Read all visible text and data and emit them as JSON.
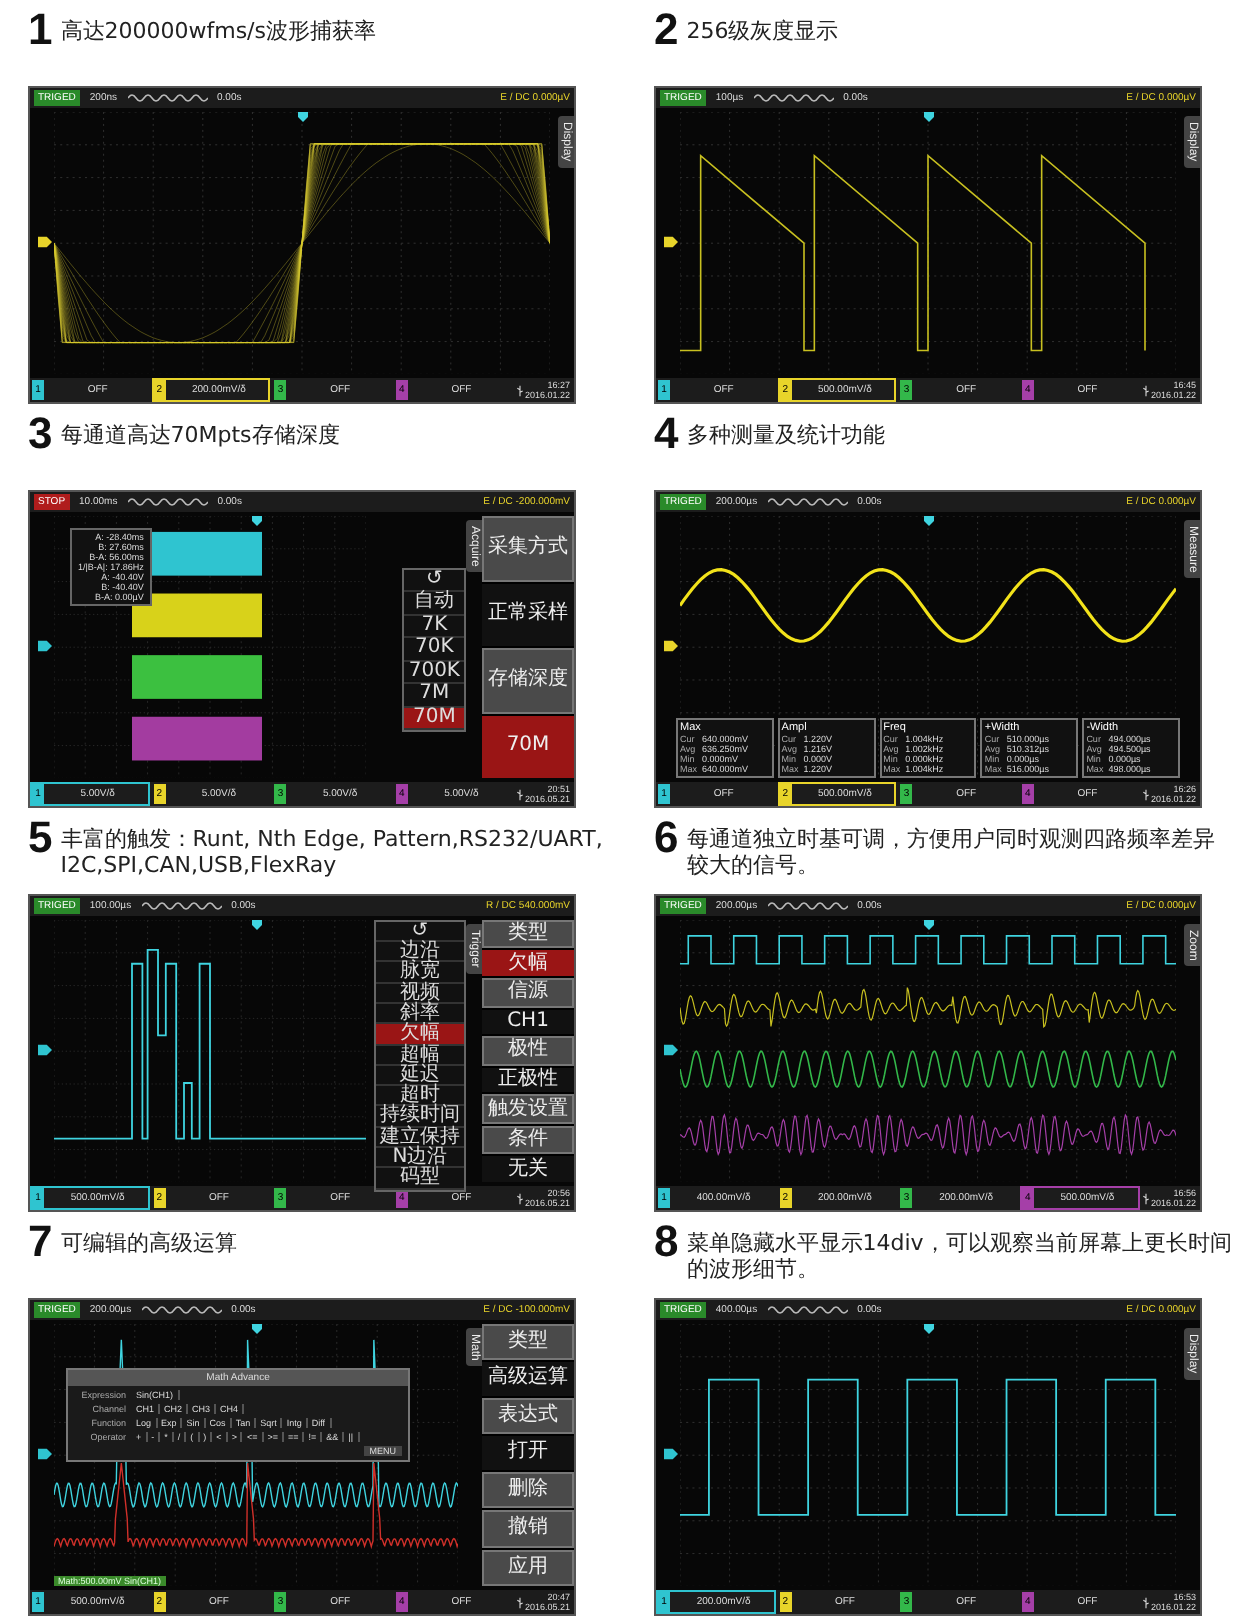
{
  "panels": [
    {
      "number": "1",
      "caption": "高达200000wfms/s波形捕获率",
      "screen": {
        "status": "TRIGED",
        "stopped": false,
        "timebase": "200ns",
        "delay": "0.00s",
        "trigger": "E / DC 0.000µV",
        "side_tab": "Display",
        "channels": [
          {
            "label": "1",
            "value": "OFF",
            "selected": false,
            "color": "#2fc4d0"
          },
          {
            "label": "2",
            "value": "200.00mV/δ",
            "selected": true,
            "color": "#e8d42a"
          },
          {
            "label": "3",
            "value": "OFF",
            "selected": false,
            "color": "#33b84a"
          },
          {
            "label": "4",
            "value": "OFF",
            "selected": false,
            "color": "#a53fa8"
          }
        ],
        "time": "16:27",
        "date": "2016.01.22"
      }
    },
    {
      "number": "2",
      "caption": "256级灰度显示",
      "screen": {
        "status": "TRIGED",
        "stopped": false,
        "timebase": "100µs",
        "delay": "0.00s",
        "trigger": "E / DC 0.000µV",
        "side_tab": "Display",
        "channels": [
          {
            "label": "1",
            "value": "OFF",
            "selected": false,
            "color": "#2fc4d0"
          },
          {
            "label": "2",
            "value": "500.00mV/δ",
            "selected": true,
            "color": "#e8d42a"
          },
          {
            "label": "3",
            "value": "OFF",
            "selected": false,
            "color": "#33b84a"
          },
          {
            "label": "4",
            "value": "OFF",
            "selected": false,
            "color": "#a53fa8"
          }
        ],
        "time": "16:45",
        "date": "2016.01.22"
      }
    },
    {
      "number": "3",
      "caption": "每通道高达70Mpts存储深度",
      "screen": {
        "status": "STOP",
        "stopped": true,
        "timebase": "10.00ms",
        "delay": "0.00s",
        "trigger": "E / DC -200.000mV",
        "side_tab": "Acquire",
        "cursor_readout": [
          "A: -28.40ms",
          "B: 27.60ms",
          "B-A: 56.00ms",
          "1/|B-A|: 17.86Hz",
          "A: -40.40V",
          "B: -40.40V",
          "B-A: 0.00µV"
        ],
        "popup_list": [
          {
            "label": "↺",
            "selected": false
          },
          {
            "label": "自动",
            "selected": false
          },
          {
            "label": "7K",
            "selected": false
          },
          {
            "label": "70K",
            "selected": false
          },
          {
            "label": "700K",
            "selected": false
          },
          {
            "label": "7M",
            "selected": false
          },
          {
            "label": "70M",
            "selected": true
          }
        ],
        "menu": [
          {
            "kind": "header",
            "label": "采集方式",
            "selected": false
          },
          {
            "kind": "value",
            "label": "正常采样",
            "selected": false
          },
          {
            "kind": "header",
            "label": "存储深度",
            "selected": false
          },
          {
            "kind": "value",
            "label": "70M",
            "selected": true
          }
        ],
        "channels": [
          {
            "label": "1",
            "value": "5.00V/δ",
            "selected": true,
            "color": "#2fc4d0"
          },
          {
            "label": "2",
            "value": "5.00V/δ",
            "selected": false,
            "color": "#e8d42a"
          },
          {
            "label": "3",
            "value": "5.00V/δ",
            "selected": false,
            "color": "#33b84a"
          },
          {
            "label": "4",
            "value": "5.00V/δ",
            "selected": false,
            "color": "#a53fa8"
          }
        ],
        "time": "20:51",
        "date": "2016.05.21"
      }
    },
    {
      "number": "4",
      "caption": "多种测量及统计功能",
      "screen": {
        "status": "TRIGED",
        "stopped": false,
        "timebase": "200.00µs",
        "delay": "0.00s",
        "trigger": "E / DC 0.000µV",
        "side_tab": "Measure",
        "measurements": [
          {
            "name": "Max",
            "rows": [
              {
                "label": "Cur",
                "value": "640.000mV"
              },
              {
                "label": "Avg",
                "value": "636.250mV"
              },
              {
                "label": "Min",
                "value": "0.000mV"
              },
              {
                "label": "Max",
                "value": "640.000mV"
              }
            ]
          },
          {
            "name": "Ampl",
            "rows": [
              {
                "label": "Cur",
                "value": "1.220V"
              },
              {
                "label": "Avg",
                "value": "1.216V"
              },
              {
                "label": "Min",
                "value": "0.000V"
              },
              {
                "label": "Max",
                "value": "1.220V"
              }
            ]
          },
          {
            "name": "Freq",
            "rows": [
              {
                "label": "Cur",
                "value": "1.004kHz"
              },
              {
                "label": "Avg",
                "value": "1.002kHz"
              },
              {
                "label": "Min",
                "value": "0.000kHz"
              },
              {
                "label": "Max",
                "value": "1.004kHz"
              }
            ]
          },
          {
            "name": "+Width",
            "rows": [
              {
                "label": "Cur",
                "value": "510.000µs"
              },
              {
                "label": "Avg",
                "value": "510.312µs"
              },
              {
                "label": "Min",
                "value": "0.000µs"
              },
              {
                "label": "Max",
                "value": "516.000µs"
              }
            ]
          },
          {
            "name": "-Width",
            "rows": [
              {
                "label": "Cur",
                "value": "494.000µs"
              },
              {
                "label": "Avg",
                "value": "494.500µs"
              },
              {
                "label": "Min",
                "value": "0.000µs"
              },
              {
                "label": "Max",
                "value": "498.000µs"
              }
            ]
          }
        ],
        "channels": [
          {
            "label": "1",
            "value": "OFF",
            "selected": false,
            "color": "#2fc4d0"
          },
          {
            "label": "2",
            "value": "500.00mV/δ",
            "selected": true,
            "color": "#e8d42a"
          },
          {
            "label": "3",
            "value": "OFF",
            "selected": false,
            "color": "#33b84a"
          },
          {
            "label": "4",
            "value": "OFF",
            "selected": false,
            "color": "#a53fa8"
          }
        ],
        "time": "16:26",
        "date": "2016.01.22"
      }
    },
    {
      "number": "5",
      "caption": "丰富的触发：Runt, Nth Edge, Pattern,RS232/UART, I2C,SPI,CAN,USB,FlexRay",
      "screen": {
        "status": "TRIGED",
        "stopped": false,
        "timebase": "100.00µs",
        "delay": "0.00s",
        "trigger": "R / DC 540.000mV",
        "side_tab": "Trigger",
        "popup_list": [
          {
            "label": "↺",
            "selected": false
          },
          {
            "label": "边沿",
            "selected": false
          },
          {
            "label": "脉宽",
            "selected": false
          },
          {
            "label": "视频",
            "selected": false
          },
          {
            "label": "斜率",
            "selected": false
          },
          {
            "label": "欠幅",
            "selected": true
          },
          {
            "label": "超幅",
            "selected": false
          },
          {
            "label": "延迟",
            "selected": false
          },
          {
            "label": "超时",
            "selected": false
          },
          {
            "label": "持续时间",
            "selected": false
          },
          {
            "label": "建立保持",
            "selected": false
          },
          {
            "label": "N边沿",
            "selected": false
          },
          {
            "label": "码型",
            "selected": false
          }
        ],
        "menu": [
          {
            "kind": "header",
            "label": "类型",
            "selected": false
          },
          {
            "kind": "value",
            "label": "欠幅",
            "selected": true
          },
          {
            "kind": "header",
            "label": "信源",
            "selected": false
          },
          {
            "kind": "value",
            "label": "CH1",
            "selected": false
          },
          {
            "kind": "header",
            "label": "极性",
            "selected": false
          },
          {
            "kind": "value",
            "label": "正极性",
            "selected": false
          },
          {
            "kind": "header",
            "label": "触发设置",
            "selected": false
          },
          {
            "kind": "header",
            "label": "条件",
            "selected": false
          },
          {
            "kind": "value",
            "label": "无关",
            "selected": false
          }
        ],
        "channels": [
          {
            "label": "1",
            "value": "500.00mV/δ",
            "selected": true,
            "color": "#2fc4d0"
          },
          {
            "label": "2",
            "value": "OFF",
            "selected": false,
            "color": "#e8d42a"
          },
          {
            "label": "3",
            "value": "OFF",
            "selected": false,
            "color": "#33b84a"
          },
          {
            "label": "4",
            "value": "OFF",
            "selected": false,
            "color": "#a53fa8"
          }
        ],
        "time": "20:56",
        "date": "2016.05.21"
      }
    },
    {
      "number": "6",
      "caption": "每通道独立时基可调，方便用户同时观测四路频率差异较大的信号。",
      "screen": {
        "status": "TRIGED",
        "stopped": false,
        "timebase": "200.00µs",
        "delay": "0.00s",
        "trigger": "E / DC 0.000µV",
        "side_tab": "Zoom",
        "channels": [
          {
            "label": "1",
            "value": "400.00mV/δ",
            "selected": false,
            "color": "#2fc4d0"
          },
          {
            "label": "2",
            "value": "200.00mV/δ",
            "selected": false,
            "color": "#e8d42a"
          },
          {
            "label": "3",
            "value": "200.00mV/δ",
            "selected": false,
            "color": "#33b84a"
          },
          {
            "label": "4",
            "value": "500.00mV/δ",
            "selected": true,
            "color": "#a53fa8"
          }
        ],
        "time": "16:56",
        "date": "2016.01.22"
      }
    },
    {
      "number": "7",
      "caption": "可编辑的高级运算",
      "screen": {
        "status": "TRIGED",
        "stopped": false,
        "timebase": "200.00µs",
        "delay": "0.00s",
        "trigger": "E / DC -100.000mV",
        "side_tab": "Math",
        "dialog": {
          "title": "Math Advance",
          "rows": [
            {
              "label": "Expression",
              "values": [
                "Sin(CH1)"
              ]
            },
            {
              "label": "Channel",
              "values": [
                "CH1",
                "CH2",
                "CH3",
                "CH4"
              ]
            },
            {
              "label": "Function",
              "values": [
                "Log",
                "Exp",
                "Sin",
                "Cos",
                "Tan",
                "Sqrt",
                "Intg",
                "Diff"
              ]
            },
            {
              "label": "Operator",
              "values": [
                "+",
                "-",
                "*",
                "/",
                "(",
                ")",
                "<",
                ">",
                "<=",
                ">=",
                "==",
                "!=",
                "&&",
                "||"
              ]
            }
          ],
          "button": "MENU"
        },
        "math_label": "Math:500.00mV Sin(CH1)",
        "menu": [
          {
            "kind": "header",
            "label": "类型",
            "selected": false
          },
          {
            "kind": "value",
            "label": "高级运算",
            "selected": false
          },
          {
            "kind": "header",
            "label": "表达式",
            "selected": false
          },
          {
            "kind": "value",
            "label": "打开",
            "selected": false
          },
          {
            "kind": "header",
            "label": "删除",
            "selected": false
          },
          {
            "kind": "header",
            "label": "撤销",
            "selected": false
          },
          {
            "kind": "header",
            "label": "应用",
            "selected": false
          }
        ],
        "channels": [
          {
            "label": "1",
            "value": "500.00mV/δ",
            "selected": false,
            "color": "#2fc4d0"
          },
          {
            "label": "2",
            "value": "OFF",
            "selected": false,
            "color": "#e8d42a"
          },
          {
            "label": "3",
            "value": "OFF",
            "selected": false,
            "color": "#33b84a"
          },
          {
            "label": "4",
            "value": "OFF",
            "selected": false,
            "color": "#a53fa8"
          }
        ],
        "time": "20:47",
        "date": "2016.05.21"
      }
    },
    {
      "number": "8",
      "caption": "菜单隐藏水平显示14div，可以观察当前屏幕上更长时间的波形细节。",
      "screen": {
        "status": "TRIGED",
        "stopped": false,
        "timebase": "400.00µs",
        "delay": "0.00s",
        "trigger": "E / DC 0.000µV",
        "side_tab": "Display",
        "channels": [
          {
            "label": "1",
            "value": "200.00mV/δ",
            "selected": true,
            "color": "#2fc4d0"
          },
          {
            "label": "2",
            "value": "OFF",
            "selected": false,
            "color": "#e8d42a"
          },
          {
            "label": "3",
            "value": "OFF",
            "selected": false,
            "color": "#33b84a"
          },
          {
            "label": "4",
            "value": "OFF",
            "selected": false,
            "color": "#a53fa8"
          }
        ],
        "time": "16:53",
        "date": "2016.01.22"
      }
    }
  ]
}
